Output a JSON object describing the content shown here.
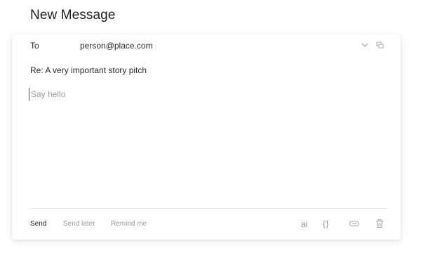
{
  "page": {
    "title": "New Message"
  },
  "compose": {
    "to_label": "To",
    "to_value": "person@place.com",
    "subject": "Re: A very important story pitch",
    "body_value": "",
    "body_placeholder": "Say hello"
  },
  "footer": {
    "send_label": "Send",
    "send_later_label": "Send later",
    "remind_label": "Remind me",
    "ai_label": "ai",
    "code_label": "{}"
  },
  "icons": {
    "expand": "chevron-down-icon",
    "cc": "copy-icon",
    "attach": "paperclip-icon",
    "trash": "trash-icon"
  },
  "colors": {
    "text": "#222222",
    "muted": "#9a9a9a",
    "divider": "#e6e6e6"
  }
}
